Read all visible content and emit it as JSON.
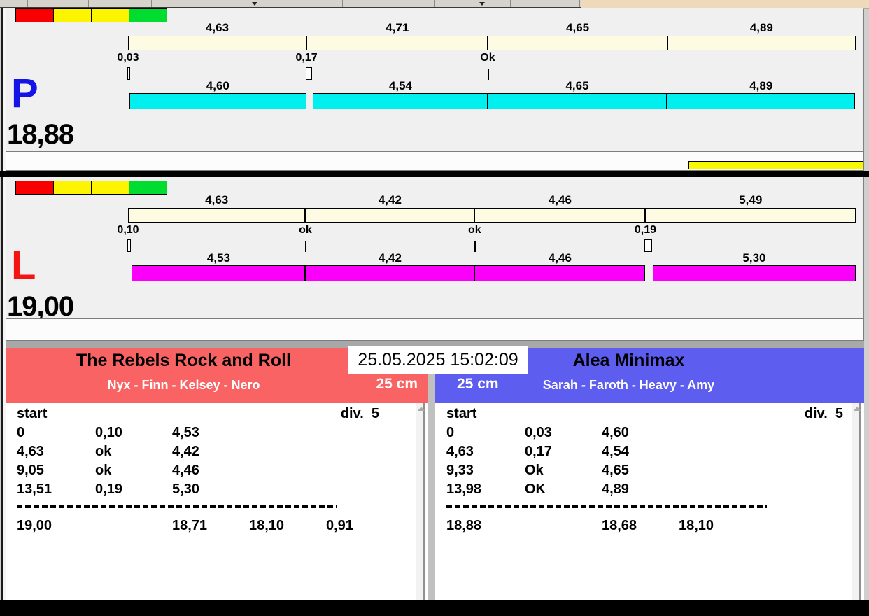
{
  "datetime": "25.05.2025 15:02:09",
  "runs": [
    {
      "letter": "P",
      "letter_color": "#1414e6",
      "total_label": "18,88",
      "total_time": 18.88,
      "status_lights": [
        "#f80000",
        "#fcf400",
        "#fcf400",
        "#00dc30"
      ],
      "ref_bar": {
        "color": "#fdfce2",
        "segments": [
          {
            "label": "4,63",
            "value": 4.63,
            "offset": 0
          },
          {
            "label": "4,71",
            "value": 4.71,
            "offset": 4.63
          },
          {
            "label": "4,65",
            "value": 4.65,
            "offset": 9.34
          },
          {
            "label": "4,89",
            "value": 4.89,
            "offset": 13.99
          }
        ]
      },
      "markers": [
        {
          "label": "0,03",
          "offset": 0,
          "kind": "penalty",
          "value": 0.03
        },
        {
          "label": "0,17",
          "offset": 4.63,
          "kind": "penalty",
          "value": 0.17
        },
        {
          "label": "Ok",
          "offset": 9.33,
          "kind": "ok"
        }
      ],
      "team_bar": {
        "color": "#00f0f0",
        "segments": [
          {
            "label": "4,60",
            "value": 4.6,
            "offset": 0.03
          },
          {
            "label": "4,54",
            "value": 4.54,
            "offset": 4.8
          },
          {
            "label": "4,65",
            "value": 4.65,
            "offset": 9.33
          },
          {
            "label": "4,89",
            "value": 4.89,
            "offset": 13.98
          }
        ]
      }
    },
    {
      "letter": "L",
      "letter_color": "#f41414",
      "total_label": "19,00",
      "total_time": 19.0,
      "status_lights": [
        "#f80000",
        "#fcf400",
        "#fcf400",
        "#00dc30"
      ],
      "ref_bar": {
        "color": "#fdfce2",
        "segments": [
          {
            "label": "4,63",
            "value": 4.63,
            "offset": 0
          },
          {
            "label": "4,42",
            "value": 4.42,
            "offset": 4.63
          },
          {
            "label": "4,46",
            "value": 4.46,
            "offset": 9.05
          },
          {
            "label": "5,49",
            "value": 5.49,
            "offset": 13.51
          }
        ]
      },
      "markers": [
        {
          "label": "0,10",
          "offset": 0,
          "kind": "penalty",
          "value": 0.1
        },
        {
          "label": "ok",
          "offset": 4.63,
          "kind": "ok"
        },
        {
          "label": "ok",
          "offset": 9.05,
          "kind": "ok"
        },
        {
          "label": "0,19",
          "offset": 13.51,
          "kind": "penalty",
          "value": 0.19
        }
      ],
      "team_bar": {
        "color": "#fa00fa",
        "segments": [
          {
            "label": "4,53",
            "value": 4.53,
            "offset": 0.1
          },
          {
            "label": "4,42",
            "value": 4.42,
            "offset": 4.63
          },
          {
            "label": "4,46",
            "value": 4.46,
            "offset": 9.05
          },
          {
            "label": "5,30",
            "value": 5.3,
            "offset": 13.7
          }
        ]
      }
    }
  ],
  "status_strips": [
    {
      "has_bar": true,
      "bar_color": "#f8f800"
    },
    {
      "has_bar": false,
      "bar_color": ""
    }
  ],
  "teams": [
    {
      "name": "The Rebels Rock and Roll",
      "members": "Nyx - Finn - Kelsey - Nero",
      "size_class": "25 cm",
      "header_color": "#f96363",
      "table": {
        "header_left": "start",
        "header_right": "div.  5",
        "rows": [
          [
            "0",
            "0,10",
            "4,53"
          ],
          [
            "4,63",
            "ok",
            "4,42"
          ],
          [
            "9,05",
            "ok",
            "4,46"
          ],
          [
            "13,51",
            "0,19",
            "5,30"
          ]
        ],
        "totals": [
          "19,00",
          "18,71",
          "18,10",
          "0,91"
        ]
      }
    },
    {
      "name": "Alea Minimax",
      "members": "Sarah - Faroth - Heavy - Amy",
      "size_class": "25 cm",
      "header_color": "#5d5df0",
      "table": {
        "header_left": "start",
        "header_right": "div.  5",
        "rows": [
          [
            "0",
            "0,03",
            "4,60"
          ],
          [
            "4,63",
            "0,17",
            "4,54"
          ],
          [
            "9,33",
            "Ok",
            "4,65"
          ],
          [
            "13,98",
            "OK",
            "4,89"
          ]
        ],
        "totals": [
          "18,88",
          "18,68",
          "18,10"
        ]
      }
    }
  ]
}
